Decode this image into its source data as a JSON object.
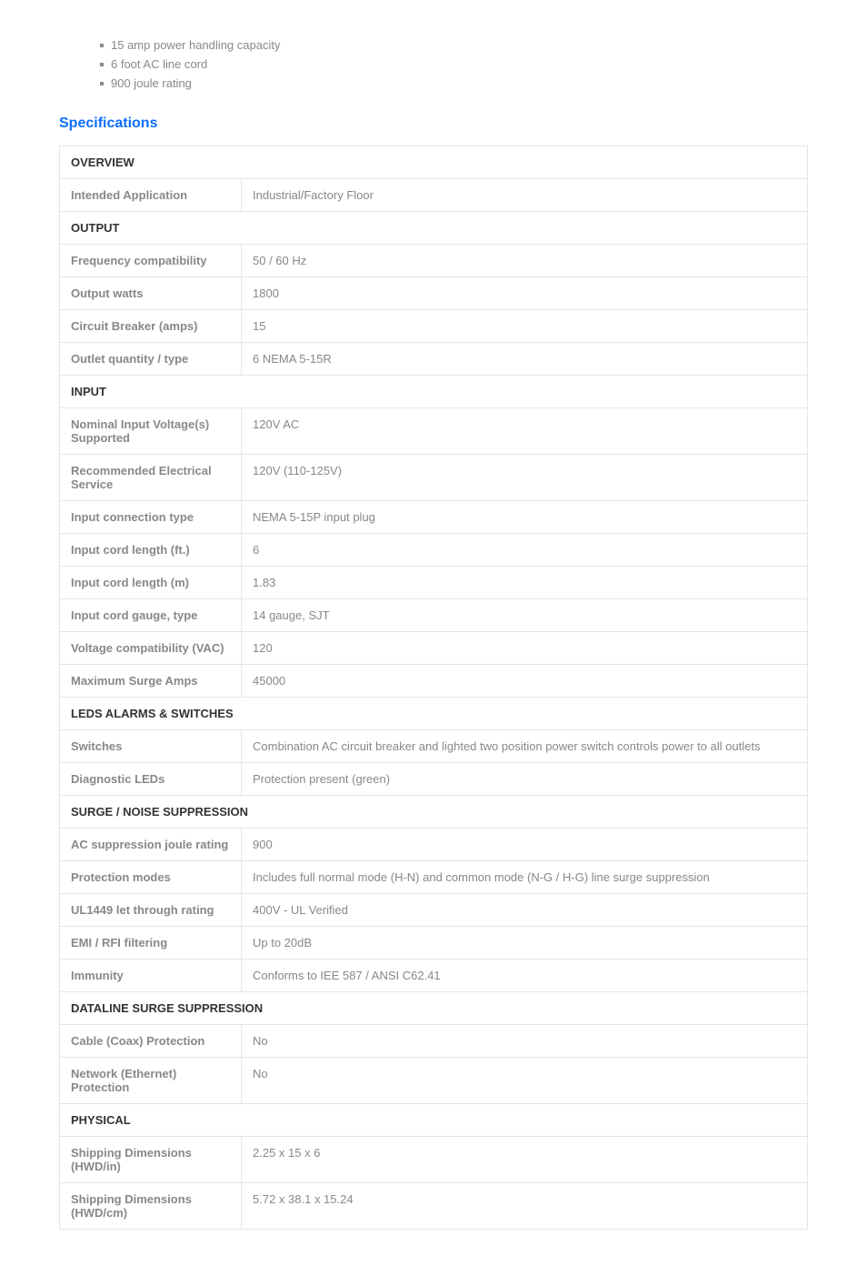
{
  "features": [
    "15 amp power handling capacity",
    "6 foot AC line cord",
    "900 joule rating"
  ],
  "heading": "Specifications",
  "sections": [
    {
      "title": "OVERVIEW",
      "rows": [
        {
          "label": "Intended Application",
          "value": "Industrial/Factory Floor"
        }
      ]
    },
    {
      "title": "OUTPUT",
      "rows": [
        {
          "label": "Frequency compatibility",
          "value": "50 / 60 Hz"
        },
        {
          "label": "Output watts",
          "value": "1800"
        },
        {
          "label": "Circuit Breaker (amps)",
          "value": "15"
        },
        {
          "label": "Outlet quantity / type",
          "value": "6 NEMA 5-15R"
        }
      ]
    },
    {
      "title": "INPUT",
      "rows": [
        {
          "label": "Nominal Input Voltage(s) Supported",
          "value": "120V AC"
        },
        {
          "label": "Recommended Electrical Service",
          "value": "120V (110-125V)"
        },
        {
          "label": "Input connection type",
          "value": "NEMA 5-15P input plug"
        },
        {
          "label": "Input cord length (ft.)",
          "value": "6"
        },
        {
          "label": "Input cord length (m)",
          "value": "1.83"
        },
        {
          "label": "Input cord gauge, type",
          "value": "14 gauge, SJT"
        },
        {
          "label": "Voltage compatibility (VAC)",
          "value": "120"
        },
        {
          "label": "Maximum Surge Amps",
          "value": "45000"
        }
      ]
    },
    {
      "title": "LEDS ALARMS & SWITCHES",
      "rows": [
        {
          "label": "Switches",
          "value": "Combination AC circuit breaker and lighted two position power switch controls power to all outlets"
        },
        {
          "label": "Diagnostic LEDs",
          "value": "Protection present (green)"
        }
      ]
    },
    {
      "title": "SURGE / NOISE SUPPRESSION",
      "rows": [
        {
          "label": "AC suppression joule rating",
          "value": "900"
        },
        {
          "label": "Protection modes",
          "value": "Includes full normal mode (H-N) and common mode (N-G / H-G) line surge suppression"
        },
        {
          "label": "UL1449 let through rating",
          "value": "400V - UL Verified"
        },
        {
          "label": "EMI / RFI filtering",
          "value": "Up to 20dB"
        },
        {
          "label": "Immunity",
          "value": "Conforms to IEE 587 / ANSI C62.41"
        }
      ]
    },
    {
      "title": "DATALINE SURGE SUPPRESSION",
      "rows": [
        {
          "label": "Cable (Coax) Protection",
          "value": "No"
        },
        {
          "label": "Network (Ethernet) Protection",
          "value": "No"
        }
      ]
    },
    {
      "title": "PHYSICAL",
      "rows": [
        {
          "label": "Shipping Dimensions (HWD/in)",
          "value": "2.25 x 15 x 6"
        },
        {
          "label": "Shipping Dimensions (HWD/cm)",
          "value": "5.72 x 38.1 x 15.24"
        }
      ]
    }
  ]
}
